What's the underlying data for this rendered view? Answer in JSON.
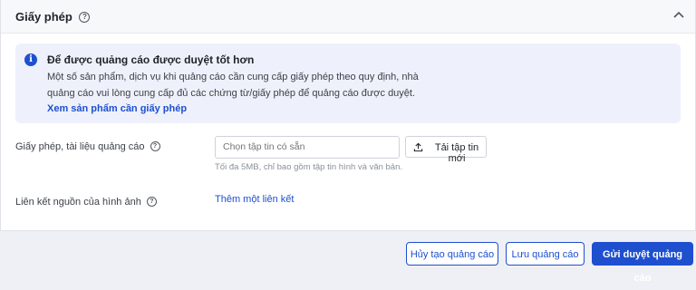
{
  "section": {
    "title": "Giấy phép",
    "help_icon": "?"
  },
  "info": {
    "icon": "i",
    "title": "Để được quảng cáo được duyệt tốt hơn",
    "body": "Một số sản phẩm, dịch vụ khi quảng cáo cần cung cấp giấy phép theo quy định, nhà quảng cáo vui lòng cung cấp đủ các chứng từ/giấy phép để quảng cáo được duyệt.",
    "link": "Xem sản phẩm cần giấy phép"
  },
  "license_field": {
    "label": "Giấy phép, tài liệu quảng cáo",
    "placeholder": "Chọn tập tin có sẵn",
    "upload_label": "Tải tập tin mới",
    "hint": "Tối đa 5MB, chỉ bao gồm tập tin hình và văn bản."
  },
  "source_field": {
    "label": "Liên kết nguồn của hình ảnh",
    "add_link": "Thêm một liên kết"
  },
  "footer": {
    "cancel": "Hủy tạo quảng cáo",
    "save": "Lưu quảng cáo",
    "submit": "Gửi duyệt quảng cáo"
  },
  "colors": {
    "accent": "#1e4fcf",
    "info_bg": "#eef1fb"
  }
}
